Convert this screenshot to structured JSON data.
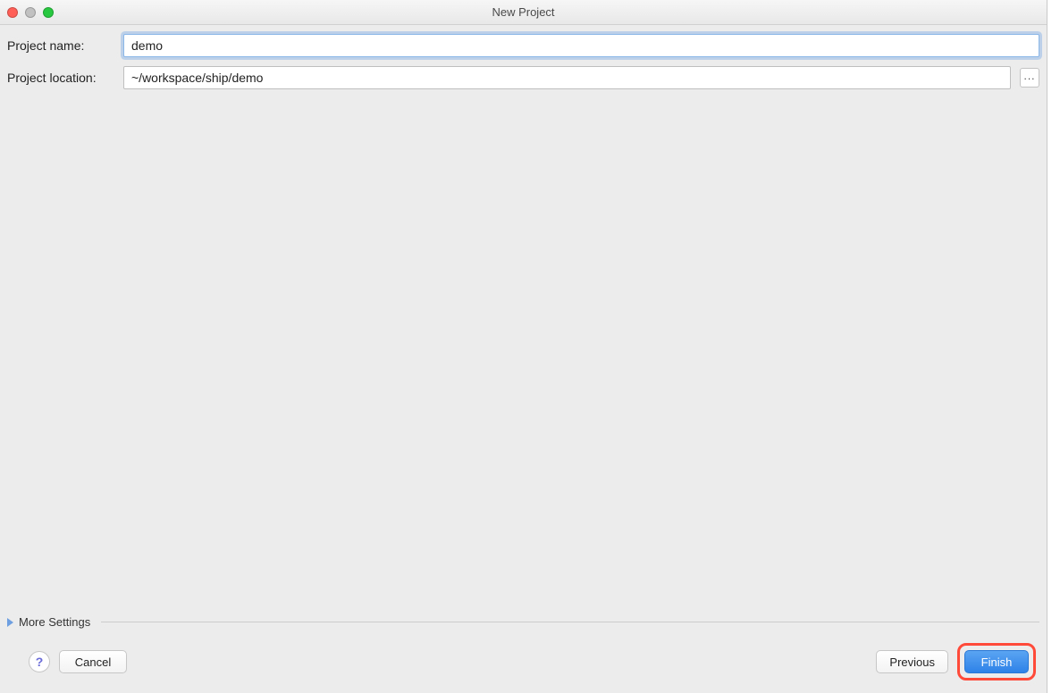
{
  "window": {
    "title": "New Project"
  },
  "form": {
    "project_name_label": "Project name:",
    "project_name_value": "demo",
    "project_location_label": "Project location:",
    "project_location_value": "~/workspace/ship/demo",
    "browse_label": "..."
  },
  "more_settings": {
    "label": "More Settings"
  },
  "buttons": {
    "help": "?",
    "cancel": "Cancel",
    "previous": "Previous",
    "finish": "Finish"
  }
}
